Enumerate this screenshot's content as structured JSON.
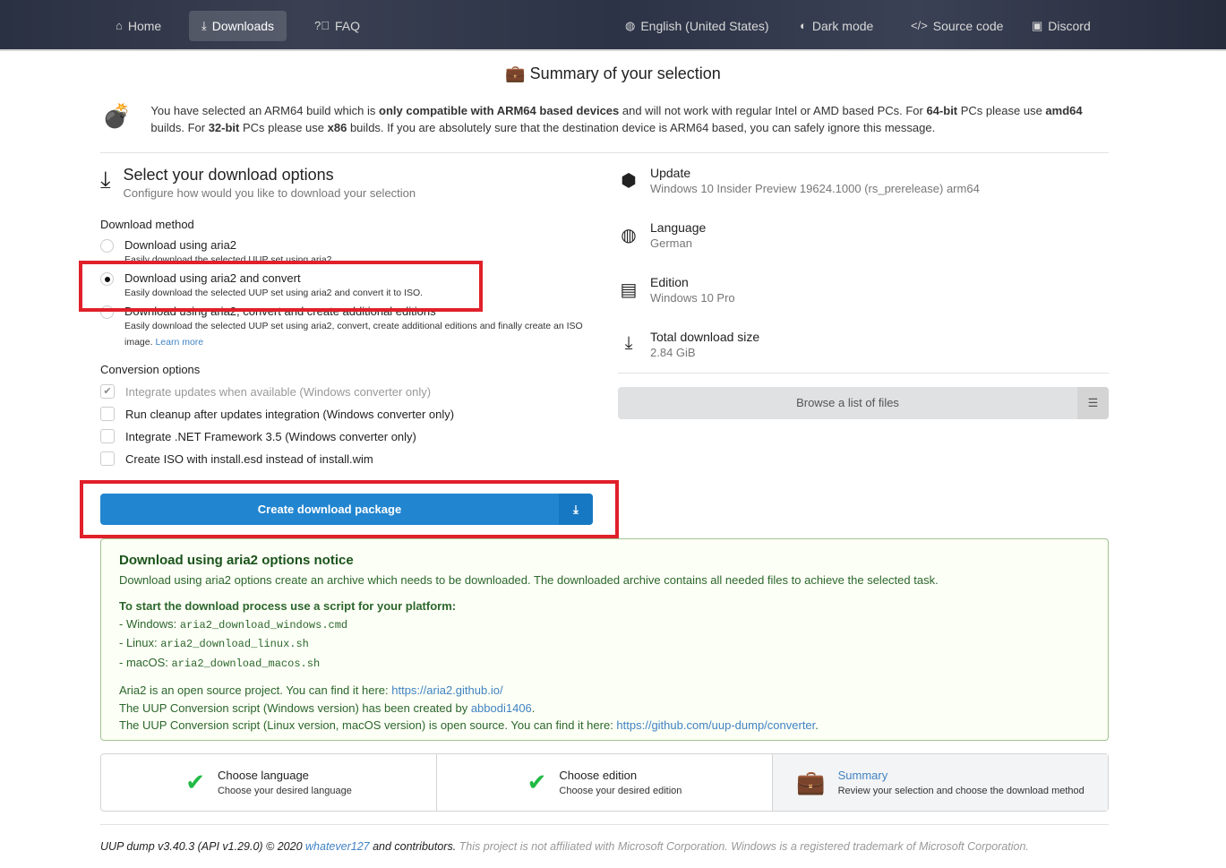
{
  "nav": {
    "home": "Home",
    "downloads": "Downloads",
    "faq": "FAQ",
    "language": "English (United States)",
    "dark_mode": "Dark mode",
    "source_code": "Source code",
    "discord": "Discord"
  },
  "page_title": "Summary of your selection",
  "warning": {
    "t1": "You have selected an ARM64 build which is ",
    "b1": "only compatible with ARM64 based devices",
    "t2": " and will not work with regular Intel or AMD based PCs. For ",
    "b2": "64-bit",
    "t3": " PCs please use ",
    "b3": "amd64",
    "t4": " builds. For ",
    "b4": "32-bit",
    "t5": " PCs please use ",
    "b5": "x86",
    "t6": " builds. If you are absolutely sure that the destination device is ARM64 based, you can safely ignore this message."
  },
  "options": {
    "title": "Select your download options",
    "subtitle": "Configure how would you like to download your selection",
    "method_label": "Download method",
    "methods": [
      {
        "label": "Download using aria2",
        "desc": "Easily download the selected UUP set using aria2."
      },
      {
        "label": "Download using aria2 and convert",
        "desc": "Easily download the selected UUP set using aria2 and convert it to ISO."
      },
      {
        "label": "Download using aria2, convert and create additional editions",
        "desc": "Easily download the selected UUP set using aria2, convert, create additional editions and finally create an ISO image.",
        "link": "Learn more"
      }
    ],
    "conversion_label": "Conversion options",
    "conversions": [
      "Integrate updates when available (Windows converter only)",
      "Run cleanup after updates integration (Windows converter only)",
      "Integrate .NET Framework 3.5 (Windows converter only)",
      "Create ISO with install.esd instead of install.wim"
    ],
    "create_button": "Create download package"
  },
  "summary": {
    "update_label": "Update",
    "update": "Windows 10 Insider Preview 19624.1000 (rs_prerelease) arm64",
    "language_label": "Language",
    "language": "German",
    "edition_label": "Edition",
    "edition": "Windows 10 Pro",
    "size_label": "Total download size",
    "size": "2.84 GiB",
    "browse": "Browse a list of files"
  },
  "notice": {
    "title": "Download using aria2 options notice",
    "p1": "Download using aria2 options create an archive which needs to be downloaded. The downloaded archive contains all needed files to achieve the selected task.",
    "start": "To start the download process use a script for your platform:",
    "win_label": "- Windows: ",
    "win": "aria2_download_windows.cmd",
    "linux_label": "- Linux: ",
    "linux": "aria2_download_linux.sh",
    "mac_label": "- macOS: ",
    "mac": "aria2_download_macos.sh",
    "aria_text": "Aria2 is an open source project. You can find it here: ",
    "aria_link": "https://aria2.github.io/",
    "conv_text": "The UUP Conversion script (Windows version) has been created by ",
    "conv_link": "abbodi1406",
    "linux_text": "The UUP Conversion script (Linux version, macOS version) is open source. You can find it here: ",
    "linux_link": "https://github.com/uup-dump/converter"
  },
  "steps": [
    {
      "title": "Choose language",
      "desc": "Choose your desired language"
    },
    {
      "title": "Choose edition",
      "desc": "Choose your desired edition"
    },
    {
      "title": "Summary",
      "desc": "Review your selection and choose the download method"
    }
  ],
  "footer": {
    "t1": "UUP dump v3.40.3 (API v1.29.0) © 2020 ",
    "link": "whatever127",
    "t2": " and contributors.",
    "muted": " This project is not affiliated with Microsoft Corporation. Windows is a registered trademark of Microsoft Corporation."
  }
}
